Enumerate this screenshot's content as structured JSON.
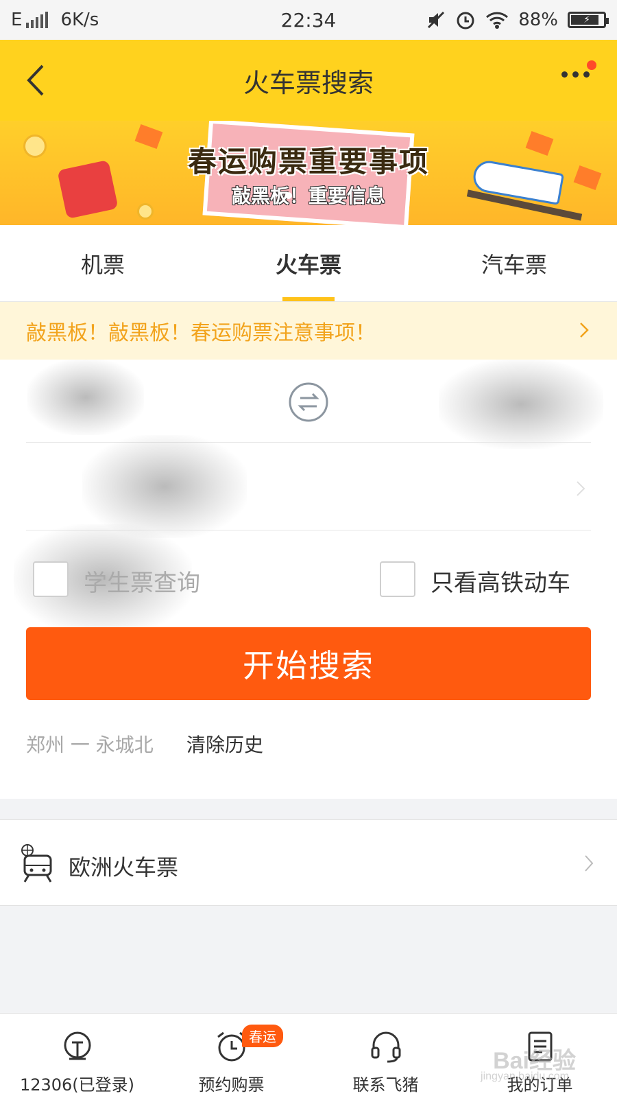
{
  "status_bar": {
    "network": "E",
    "speed": "6K/s",
    "time": "22:34",
    "battery": "88%"
  },
  "header": {
    "title": "火车票搜索",
    "back_icon": "chevron-left-icon",
    "more_icon": "more-dots-icon"
  },
  "banner": {
    "headline": "春运购票重要事项",
    "subline": "敲黑板！重要信息"
  },
  "tabs": [
    {
      "label": "机票",
      "active": false
    },
    {
      "label": "火车票",
      "active": true
    },
    {
      "label": "汽车票",
      "active": false
    }
  ],
  "notice": {
    "text": "敲黑板！敲黑板！春运购票注意事项！"
  },
  "form": {
    "student_ticket_label": "学生票查询",
    "high_speed_only_label": "只看高铁动车",
    "search_button": "开始搜索",
    "history_item": "郑州 一 永城北",
    "clear_history": "清除历史"
  },
  "europe": {
    "label": "欧洲火车票",
    "icon": "train-globe-icon"
  },
  "bottom_nav": [
    {
      "label": "12306(已登录)",
      "icon": "railway-logo-icon"
    },
    {
      "label": "预约购票",
      "icon": "alarm-clock-icon",
      "badge": "春运"
    },
    {
      "label": "联系飞猪",
      "icon": "headset-icon"
    },
    {
      "label": "我的订单",
      "icon": "order-list-icon"
    }
  ],
  "watermark": {
    "text": "Bai经验",
    "sub": "jingyan.baidu.com"
  },
  "colors": {
    "header_yellow": "#ffd21e",
    "search_orange": "#ff5a0f",
    "notice_text": "#f2a31c",
    "tab_underline": "#ffc21a"
  }
}
